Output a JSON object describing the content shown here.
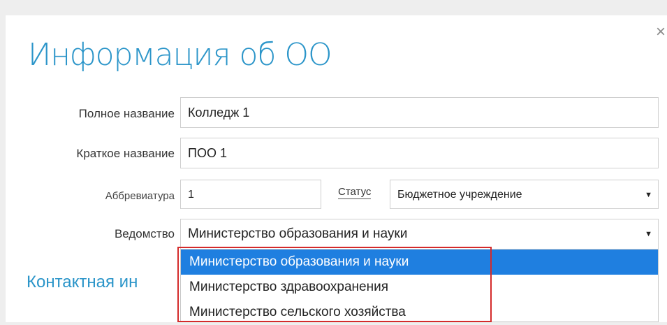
{
  "dialog": {
    "title": "Информация об ОО",
    "close_glyph": "×"
  },
  "form": {
    "full_name": {
      "label": "Полное название",
      "value": "Колледж 1"
    },
    "short_name": {
      "label": "Краткое название",
      "value": "ПОО 1"
    },
    "abbreviation": {
      "label": "Аббревиатура",
      "value": "1"
    },
    "status": {
      "label": "Статус",
      "value": "Бюджетное учреждение"
    },
    "department": {
      "label": "Ведомство",
      "value": "Министерство образования и науки",
      "options": [
        "Министерство образования и науки",
        "Министерство здравоохранения",
        "Министерство сельского хозяйства"
      ],
      "highlighted_option_index": 0
    }
  },
  "section": {
    "contact_title": "Контактная ин"
  },
  "icons": {
    "close": "close-icon",
    "dropdown_arrow": "caret-down-icon"
  },
  "colors": {
    "title": "#2b95c9",
    "selected_option_bg": "#1f7fe0",
    "annotation_box": "#d42b2b"
  }
}
